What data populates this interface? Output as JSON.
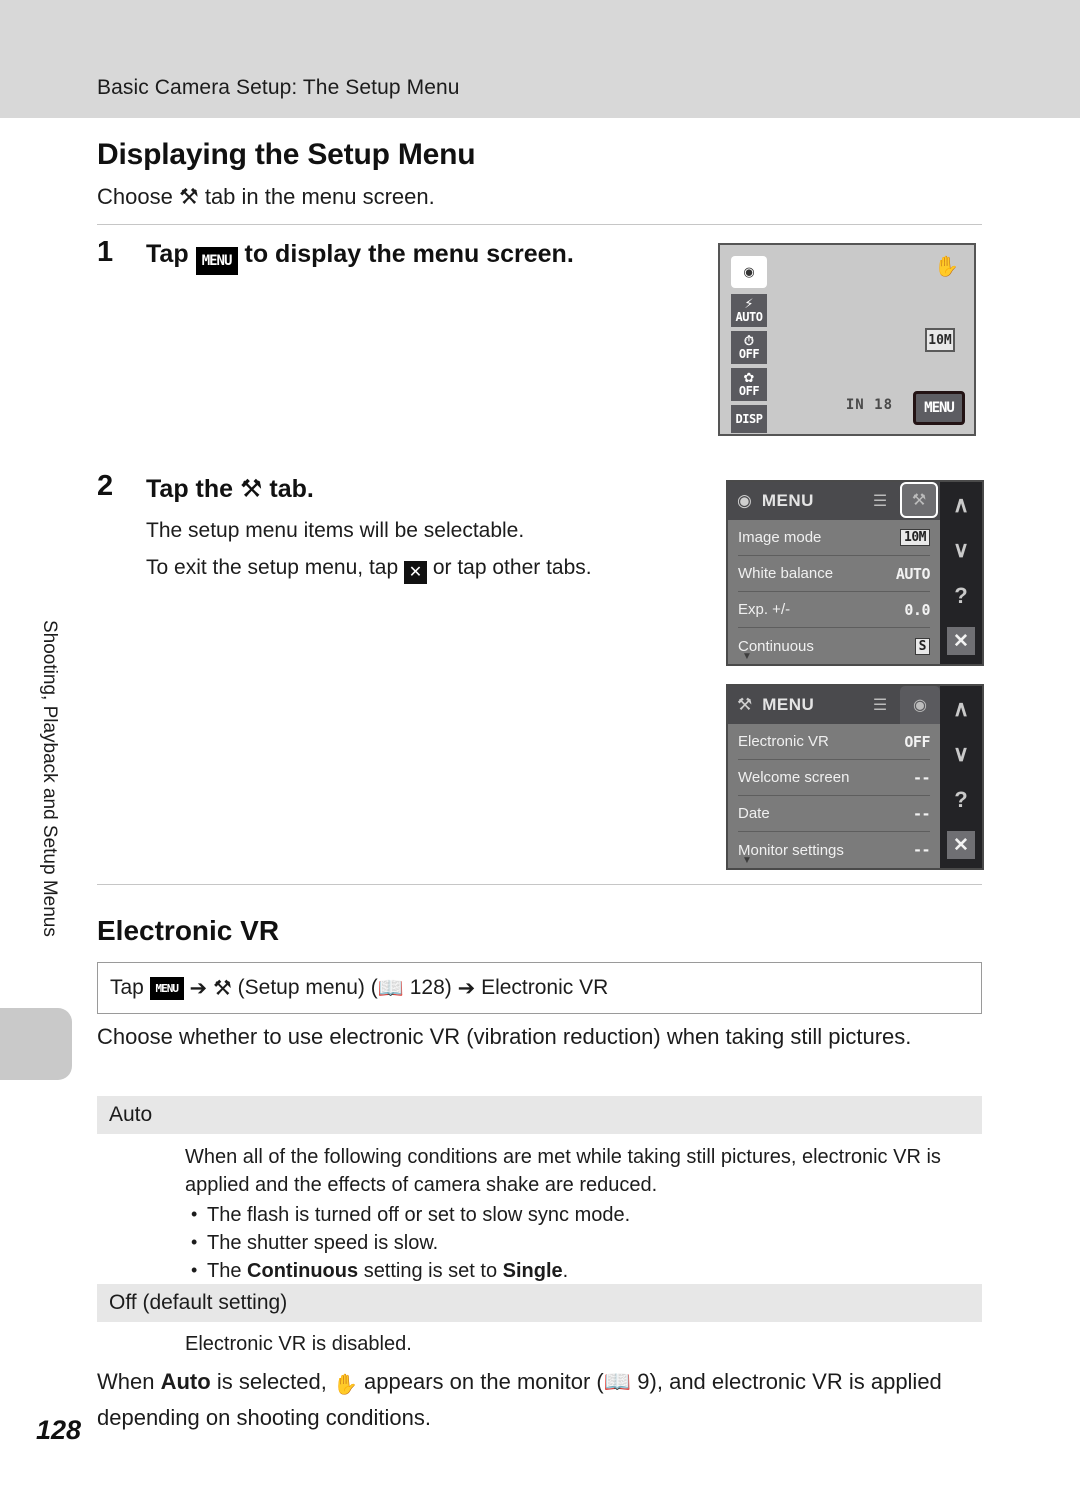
{
  "header": {
    "running_head": "Basic Camera Setup: The Setup Menu"
  },
  "side_tab": {
    "label": "Shooting, Playback and Setup Menus"
  },
  "page_number": "128",
  "section": {
    "title": "Displaying the Setup Menu",
    "intro_prefix": "Choose",
    "intro_icon": "wrench-icon",
    "intro_suffix": "tab in the menu screen."
  },
  "steps": [
    {
      "number": "1",
      "head_prefix": "Tap",
      "head_icon": "menu-button-icon",
      "head_icon_label": "MENU",
      "head_suffix": "to display the menu screen.",
      "body": []
    },
    {
      "number": "2",
      "head_prefix": "Tap the",
      "head_icon": "wrench-icon",
      "head_suffix": "tab.",
      "body": [
        "The setup menu items will be selectable.",
        "To exit the setup menu, tap"
      ],
      "body_line2_icon": "close-x-icon",
      "body_line2_suffix": "or tap other tabs."
    }
  ],
  "lcd_screen": {
    "left_buttons": [
      {
        "name": "shooting-mode-button",
        "icon": "camera-icon",
        "label": ""
      },
      {
        "name": "flash-mode-button",
        "icon": "flash-icon",
        "label": "AUTO"
      },
      {
        "name": "self-timer-button",
        "icon": "self-timer-icon",
        "label": "OFF"
      },
      {
        "name": "macro-mode-button",
        "icon": "macro-flower-icon",
        "label": "OFF"
      },
      {
        "name": "display-button",
        "icon": "",
        "label": "DISP"
      }
    ],
    "shake_icon": "camera-shake-icon",
    "image_size_badge": "10M",
    "shots_remaining": "18",
    "memory_indicator": "IN",
    "menu_button_label": "MENU"
  },
  "menu_shot_shooting": {
    "title": "MENU",
    "title_icon": "camera-icon",
    "tabs": [
      {
        "name": "playback-list-tab",
        "icon": "list-icon",
        "active": false
      },
      {
        "name": "setup-wrench-tab",
        "icon": "wrench-icon",
        "active": true
      }
    ],
    "rows": [
      {
        "label": "Image mode",
        "value": "10M",
        "boxed": true
      },
      {
        "label": "White balance",
        "value": "AUTO",
        "boxed": false
      },
      {
        "label": "Exp. +/-",
        "value": "0.0",
        "boxed": false
      },
      {
        "label": "Continuous",
        "value": "S",
        "boxed": true
      }
    ],
    "rail": [
      {
        "name": "scroll-up-button",
        "glyph": "∧"
      },
      {
        "name": "scroll-down-button",
        "glyph": "∨"
      },
      {
        "name": "help-button",
        "glyph": "?"
      },
      {
        "name": "close-button",
        "glyph": "✕"
      }
    ]
  },
  "menu_shot_setup": {
    "title": "MENU",
    "title_icon": "wrench-icon",
    "tabs": [
      {
        "name": "movie-list-tab",
        "icon": "list-icon",
        "active": false
      },
      {
        "name": "shooting-camera-tab",
        "icon": "camera-icon",
        "active": false
      }
    ],
    "rows": [
      {
        "label": "Electronic VR",
        "value": "OFF",
        "boxed": false
      },
      {
        "label": "Welcome screen",
        "value": "--",
        "boxed": false
      },
      {
        "label": "Date",
        "value": "--",
        "boxed": false
      },
      {
        "label": "Monitor settings",
        "value": "--",
        "boxed": false
      }
    ],
    "rail": [
      {
        "name": "scroll-up-button",
        "glyph": "∧"
      },
      {
        "name": "scroll-down-button",
        "glyph": "∨"
      },
      {
        "name": "help-button",
        "glyph": "?"
      },
      {
        "name": "close-button",
        "glyph": "✕"
      }
    ]
  },
  "topic": {
    "title": "Electronic VR",
    "nav_prefix": "Tap",
    "nav_menu_label": "MENU",
    "nav_mid": "(Setup menu)",
    "nav_page_ref": "128",
    "nav_end": "Electronic VR",
    "intro": "Choose whether to use electronic VR (vibration reduction) when taking still pictures.",
    "auto_heading": "Auto",
    "auto_desc": "When all of the following conditions are met while taking still pictures, electronic VR is applied and the effects of camera shake are reduced.",
    "auto_bullets": [
      "The flash is turned off or set to slow sync mode.",
      "The shutter speed is slow."
    ],
    "auto_bullet_bold": {
      "prefix": "The",
      "bold1": "Continuous",
      "mid": "setting is set to",
      "bold2": "Single",
      "suffix": "."
    },
    "off_heading": "Off (default setting)",
    "off_desc": "Electronic VR is disabled.",
    "closing": {
      "prefix": "When",
      "bold": "Auto",
      "mid": "is selected,",
      "icon": "electronic-vr-icon",
      "mid2": "appears on the monitor (",
      "page_ref": "9",
      "suffix": "), and electronic VR is applied depending on shooting conditions."
    }
  },
  "colors": {
    "header_band": "#d8d8d8",
    "lcd_bg": "#c9c9c9",
    "menu_panel": "#7b7b7b",
    "menu_rail": "#232326",
    "band_head": "#e7e7e7",
    "highlight_border": "#231314"
  }
}
